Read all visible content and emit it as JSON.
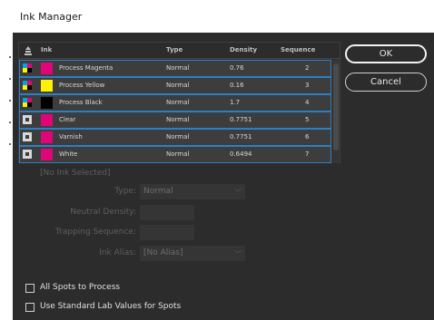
{
  "window": {
    "title": "Ink Manager"
  },
  "list": {
    "columns": {
      "ink": "Ink",
      "type": "Type",
      "density": "Density",
      "sequence": "Sequence"
    },
    "rows": [
      {
        "name": "Process Magenta",
        "type": "Normal",
        "density": "0.76",
        "sequence": "2",
        "swatch": "#e0067a",
        "kind": "process"
      },
      {
        "name": "Process Yellow",
        "type": "Normal",
        "density": "0.16",
        "sequence": "3",
        "swatch": "#fff200",
        "kind": "process"
      },
      {
        "name": "Process Black",
        "type": "Normal",
        "density": "1.7",
        "sequence": "4",
        "swatch": "#000000",
        "kind": "process"
      },
      {
        "name": "Clear",
        "type": "Normal",
        "density": "0.7751",
        "sequence": "5",
        "swatch": "#e0067a",
        "kind": "spot"
      },
      {
        "name": "Varnish",
        "type": "Normal",
        "density": "0.7751",
        "sequence": "6",
        "swatch": "#e0067a",
        "kind": "spot"
      },
      {
        "name": "White",
        "type": "Normal",
        "density": "0.6494",
        "sequence": "7",
        "swatch": "#e0067a",
        "kind": "spot"
      }
    ]
  },
  "buttons": {
    "ok": "OK",
    "cancel": "Cancel"
  },
  "details": {
    "no_ink": "[No Ink Selected]",
    "type_label": "Type:",
    "type_value": "Normal",
    "neutral_density_label": "Neutral Density:",
    "trapping_sequence_label": "Trapping Sequence:",
    "ink_alias_label": "Ink Alias:",
    "ink_alias_value": "[No Alias]"
  },
  "options": {
    "all_spots": "All Spots to Process",
    "standard_lab": "Use Standard Lab Values for Spots"
  },
  "colors": {
    "accent": "#2d7fc4",
    "panel": "#2c2c2c",
    "row": "#3d3d3d"
  }
}
